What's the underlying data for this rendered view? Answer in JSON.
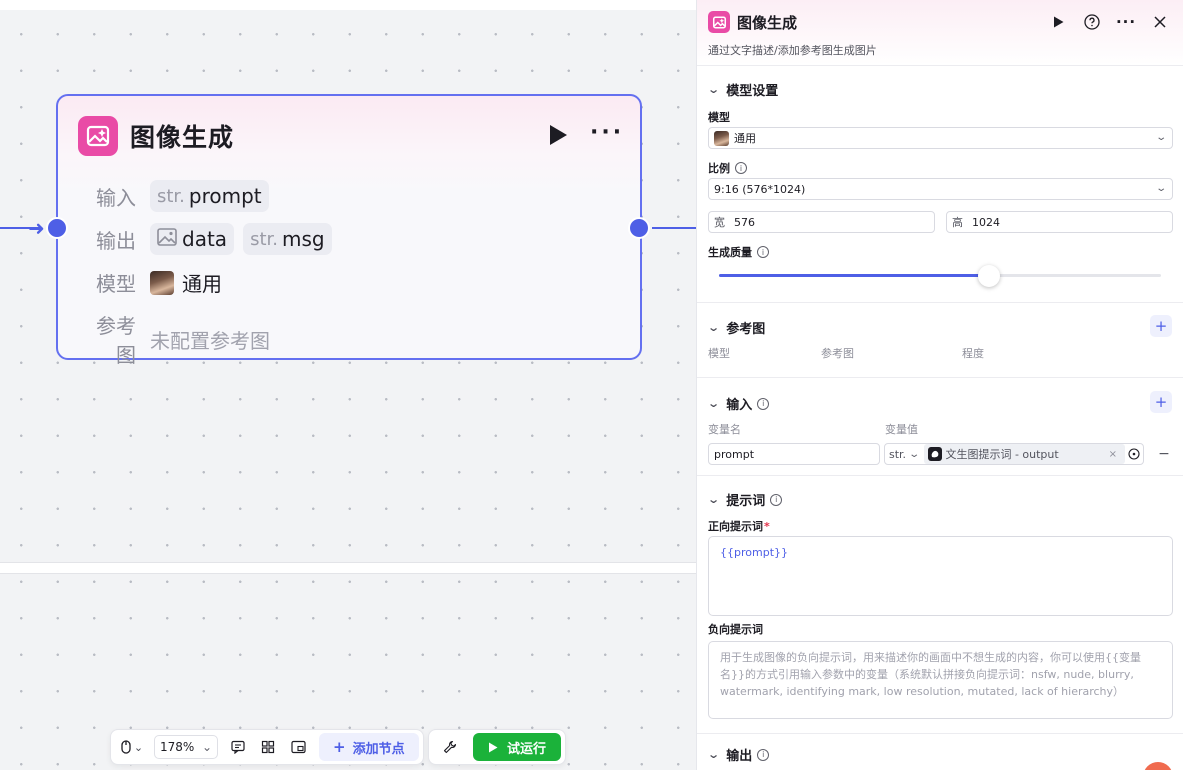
{
  "node": {
    "title": "图像生成",
    "input_label": "输入",
    "output_label": "输出",
    "model_label": "模型",
    "ref_label": "参考图",
    "inputs": [
      {
        "type": "str.",
        "name": "prompt"
      }
    ],
    "outputs": [
      {
        "type": "image",
        "name": "data"
      },
      {
        "type": "str.",
        "name": "msg"
      }
    ],
    "model_value": "通用",
    "ref_value": "未配置参考图"
  },
  "toolbar": {
    "zoom": "178%",
    "add_node": "添加节点",
    "run": "试运行"
  },
  "panel": {
    "title": "图像生成",
    "description": "通过文字描述/添加参考图生成图片",
    "model_settings": {
      "title": "模型设置",
      "model_label": "模型",
      "model_value": "通用",
      "ratio_label": "比例",
      "ratio_value": "9:16 (576*1024)",
      "width_prefix": "宽",
      "width_value": "576",
      "height_prefix": "高",
      "height_value": "1024",
      "quality_label": "生成质量",
      "quality_level": 0.61
    },
    "reference": {
      "title": "参考图",
      "col_model": "模型",
      "col_ref": "参考图",
      "col_degree": "程度"
    },
    "inputs": {
      "title": "输入",
      "col_name": "变量名",
      "col_value": "变量值",
      "var_name": "prompt",
      "var_type": "str.",
      "var_ref": "文生图提示词 - output"
    },
    "prompt": {
      "title": "提示词",
      "positive_label": "正向提示词",
      "positive_value": "{{prompt}}",
      "negative_label": "负向提示词",
      "negative_placeholder": "用于生成图像的负向提示词，用来描述你的画面中不想生成的内容，你可以使用{{变量名}}的方式引用输入参数中的变量（系统默认拼接负向提示词：nsfw, nude, blurry, watermark, identifying mark, low resolution, mutated, lack of hierarchy）"
    },
    "outputs": {
      "title": "输出"
    }
  },
  "colors": {
    "accent": "#4e5fe6",
    "brand_pink": "#e94ba6",
    "run_green": "#1bb23a"
  }
}
